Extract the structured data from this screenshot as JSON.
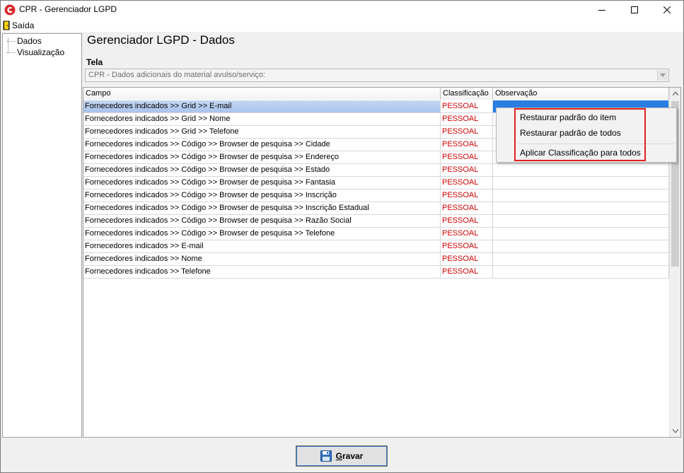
{
  "window": {
    "title": "CPR - Gerenciador LGPD",
    "brand_color": "#d8262b"
  },
  "menu": {
    "exit_label": "Saída"
  },
  "tree": {
    "items": [
      {
        "label": "Dados"
      },
      {
        "label": "Visualização"
      }
    ]
  },
  "page": {
    "title": "Gerenciador LGPD - Dados",
    "tela_label": "Tela",
    "tela_value": "CPR - Dados adicionais do material avulso/serviço:"
  },
  "grid": {
    "columns": [
      "Campo",
      "Classificação",
      "Observação"
    ],
    "rows": [
      {
        "campo": "Fornecedores indicados >> Grid >> E-mail",
        "classificacao": "PESSOAL",
        "observacao": ""
      },
      {
        "campo": "Fornecedores indicados >> Grid >> Nome",
        "classificacao": "PESSOAL",
        "observacao": ""
      },
      {
        "campo": "Fornecedores indicados >> Grid >> Telefone",
        "classificacao": "PESSOAL",
        "observacao": ""
      },
      {
        "campo": "Fornecedores indicados >> Código >> Browser de pesquisa >> Cidade",
        "classificacao": "PESSOAL",
        "observacao": ""
      },
      {
        "campo": "Fornecedores indicados >> Código >> Browser de pesquisa >> Endereço",
        "classificacao": "PESSOAL",
        "observacao": ""
      },
      {
        "campo": "Fornecedores indicados >> Código >> Browser de pesquisa >> Estado",
        "classificacao": "PESSOAL",
        "observacao": ""
      },
      {
        "campo": "Fornecedores indicados >> Código >> Browser de pesquisa >> Fantasia",
        "classificacao": "PESSOAL",
        "observacao": ""
      },
      {
        "campo": "Fornecedores indicados >> Código >> Browser de pesquisa >> Inscrição",
        "classificacao": "PESSOAL",
        "observacao": ""
      },
      {
        "campo": "Fornecedores indicados >> Código >> Browser de pesquisa >> Inscrição Estadual",
        "classificacao": "PESSOAL",
        "observacao": ""
      },
      {
        "campo": "Fornecedores indicados >> Código >> Browser de pesquisa >> Razão Social",
        "classificacao": "PESSOAL",
        "observacao": ""
      },
      {
        "campo": "Fornecedores indicados >> Código >> Browser de pesquisa >> Telefone",
        "classificacao": "PESSOAL",
        "observacao": ""
      },
      {
        "campo": "Fornecedores indicados >> E-mail",
        "classificacao": "PESSOAL",
        "observacao": ""
      },
      {
        "campo": "Fornecedores indicados >> Nome",
        "classificacao": "PESSOAL",
        "observacao": ""
      },
      {
        "campo": "Fornecedores indicados >> Telefone",
        "classificacao": "PESSOAL",
        "observacao": ""
      }
    ],
    "classification_color": "#d40000",
    "selected_row": 0
  },
  "context_menu": {
    "items": [
      {
        "label": "Restaurar padrão do item"
      },
      {
        "label": "Restaurar padrão de todos"
      },
      {
        "label": "Aplicar Classificação para todos"
      }
    ],
    "highlight_color": "#e0201f"
  },
  "footer": {
    "save_label_first": "G",
    "save_label_rest": "ravar"
  }
}
